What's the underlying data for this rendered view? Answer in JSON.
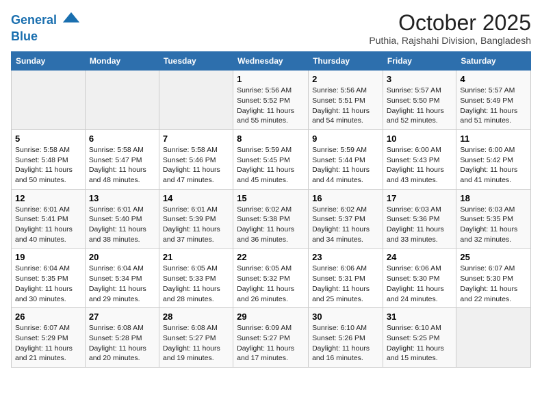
{
  "logo": {
    "line1": "General",
    "line2": "Blue"
  },
  "title": "October 2025",
  "subtitle": "Puthia, Rajshahi Division, Bangladesh",
  "days_of_week": [
    "Sunday",
    "Monday",
    "Tuesday",
    "Wednesday",
    "Thursday",
    "Friday",
    "Saturday"
  ],
  "weeks": [
    [
      {
        "day": "",
        "info": ""
      },
      {
        "day": "",
        "info": ""
      },
      {
        "day": "",
        "info": ""
      },
      {
        "day": "1",
        "sunrise": "5:56 AM",
        "sunset": "5:52 PM",
        "daylight": "11 hours and 55 minutes."
      },
      {
        "day": "2",
        "sunrise": "5:56 AM",
        "sunset": "5:51 PM",
        "daylight": "11 hours and 54 minutes."
      },
      {
        "day": "3",
        "sunrise": "5:57 AM",
        "sunset": "5:50 PM",
        "daylight": "11 hours and 52 minutes."
      },
      {
        "day": "4",
        "sunrise": "5:57 AM",
        "sunset": "5:49 PM",
        "daylight": "11 hours and 51 minutes."
      }
    ],
    [
      {
        "day": "5",
        "sunrise": "5:58 AM",
        "sunset": "5:48 PM",
        "daylight": "11 hours and 50 minutes."
      },
      {
        "day": "6",
        "sunrise": "5:58 AM",
        "sunset": "5:47 PM",
        "daylight": "11 hours and 48 minutes."
      },
      {
        "day": "7",
        "sunrise": "5:58 AM",
        "sunset": "5:46 PM",
        "daylight": "11 hours and 47 minutes."
      },
      {
        "day": "8",
        "sunrise": "5:59 AM",
        "sunset": "5:45 PM",
        "daylight": "11 hours and 45 minutes."
      },
      {
        "day": "9",
        "sunrise": "5:59 AM",
        "sunset": "5:44 PM",
        "daylight": "11 hours and 44 minutes."
      },
      {
        "day": "10",
        "sunrise": "6:00 AM",
        "sunset": "5:43 PM",
        "daylight": "11 hours and 43 minutes."
      },
      {
        "day": "11",
        "sunrise": "6:00 AM",
        "sunset": "5:42 PM",
        "daylight": "11 hours and 41 minutes."
      }
    ],
    [
      {
        "day": "12",
        "sunrise": "6:01 AM",
        "sunset": "5:41 PM",
        "daylight": "11 hours and 40 minutes."
      },
      {
        "day": "13",
        "sunrise": "6:01 AM",
        "sunset": "5:40 PM",
        "daylight": "11 hours and 38 minutes."
      },
      {
        "day": "14",
        "sunrise": "6:01 AM",
        "sunset": "5:39 PM",
        "daylight": "11 hours and 37 minutes."
      },
      {
        "day": "15",
        "sunrise": "6:02 AM",
        "sunset": "5:38 PM",
        "daylight": "11 hours and 36 minutes."
      },
      {
        "day": "16",
        "sunrise": "6:02 AM",
        "sunset": "5:37 PM",
        "daylight": "11 hours and 34 minutes."
      },
      {
        "day": "17",
        "sunrise": "6:03 AM",
        "sunset": "5:36 PM",
        "daylight": "11 hours and 33 minutes."
      },
      {
        "day": "18",
        "sunrise": "6:03 AM",
        "sunset": "5:35 PM",
        "daylight": "11 hours and 32 minutes."
      }
    ],
    [
      {
        "day": "19",
        "sunrise": "6:04 AM",
        "sunset": "5:35 PM",
        "daylight": "11 hours and 30 minutes."
      },
      {
        "day": "20",
        "sunrise": "6:04 AM",
        "sunset": "5:34 PM",
        "daylight": "11 hours and 29 minutes."
      },
      {
        "day": "21",
        "sunrise": "6:05 AM",
        "sunset": "5:33 PM",
        "daylight": "11 hours and 28 minutes."
      },
      {
        "day": "22",
        "sunrise": "6:05 AM",
        "sunset": "5:32 PM",
        "daylight": "11 hours and 26 minutes."
      },
      {
        "day": "23",
        "sunrise": "6:06 AM",
        "sunset": "5:31 PM",
        "daylight": "11 hours and 25 minutes."
      },
      {
        "day": "24",
        "sunrise": "6:06 AM",
        "sunset": "5:30 PM",
        "daylight": "11 hours and 24 minutes."
      },
      {
        "day": "25",
        "sunrise": "6:07 AM",
        "sunset": "5:30 PM",
        "daylight": "11 hours and 22 minutes."
      }
    ],
    [
      {
        "day": "26",
        "sunrise": "6:07 AM",
        "sunset": "5:29 PM",
        "daylight": "11 hours and 21 minutes."
      },
      {
        "day": "27",
        "sunrise": "6:08 AM",
        "sunset": "5:28 PM",
        "daylight": "11 hours and 20 minutes."
      },
      {
        "day": "28",
        "sunrise": "6:08 AM",
        "sunset": "5:27 PM",
        "daylight": "11 hours and 19 minutes."
      },
      {
        "day": "29",
        "sunrise": "6:09 AM",
        "sunset": "5:27 PM",
        "daylight": "11 hours and 17 minutes."
      },
      {
        "day": "30",
        "sunrise": "6:10 AM",
        "sunset": "5:26 PM",
        "daylight": "11 hours and 16 minutes."
      },
      {
        "day": "31",
        "sunrise": "6:10 AM",
        "sunset": "5:25 PM",
        "daylight": "11 hours and 15 minutes."
      },
      {
        "day": "",
        "info": ""
      }
    ]
  ]
}
